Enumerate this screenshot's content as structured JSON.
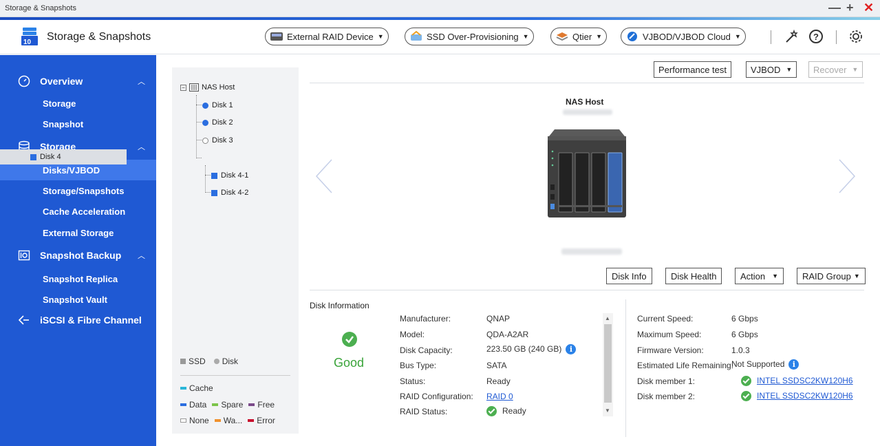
{
  "window": {
    "title": "Storage & Snapshots",
    "minimize": "—",
    "maximize": "+",
    "close": "✕"
  },
  "header": {
    "app_title": "Storage & Snapshots",
    "buttons": [
      {
        "label": "External RAID Device",
        "icon": "raid-device-icon"
      },
      {
        "label": "SSD Over-Provisioning",
        "icon": "ssd-overprovisioning-icon"
      },
      {
        "label": "Qtier",
        "icon": "qtier-icon"
      },
      {
        "label": "VJBOD/VJBOD Cloud",
        "icon": "vjbod-cloud-icon"
      }
    ]
  },
  "sidebar": {
    "groups": [
      {
        "label": "Overview",
        "icon": "speedometer-icon",
        "items": [
          "Storage",
          "Snapshot"
        ]
      },
      {
        "label": "Storage",
        "icon": "database-icon",
        "items": [
          "Disks/VJBOD",
          "Storage/Snapshots",
          "Cache Acceleration",
          "External Storage"
        ]
      },
      {
        "label": "Snapshot Backup",
        "icon": "camera-icon",
        "items": [
          "Snapshot Replica",
          "Snapshot Vault"
        ]
      },
      {
        "label": "iSCSI & Fibre Channel",
        "icon": "iscsi-icon",
        "items": []
      }
    ],
    "active_item": "Disks/VJBOD"
  },
  "tree": {
    "root": "NAS Host",
    "nodes": [
      {
        "label": "Disk 1",
        "type": "disk"
      },
      {
        "label": "Disk 2",
        "type": "disk"
      },
      {
        "label": "Disk 3",
        "type": "empty"
      },
      {
        "label": "Disk 4",
        "type": "ssd"
      },
      {
        "label": "Disk 4-1",
        "type": "ssd"
      },
      {
        "label": "Disk 4-2",
        "type": "ssd"
      }
    ],
    "legend": {
      "ssd": "SSD",
      "disk": "Disk",
      "cache": "Cache",
      "data": "Data",
      "spare": "Spare",
      "free": "Free",
      "none": "None",
      "warning": "Wa...",
      "error": "Error",
      "colors": {
        "cache": "#29b6d8",
        "data": "#2b6ee0",
        "spare": "#7cc44a",
        "free": "#7b4a8a",
        "warning": "#f0912e",
        "error": "#c8102e"
      }
    }
  },
  "top_buttons": {
    "performance": "Performance test",
    "vjbod": "VJBOD",
    "recover": "Recover"
  },
  "device": {
    "title": "NAS Host"
  },
  "action_buttons": {
    "disk_info": "Disk Info",
    "disk_health": "Disk Health",
    "action": "Action",
    "raid_group": "RAID Group"
  },
  "disk_info": {
    "section_label": "Disk Information",
    "status": "Good",
    "left": [
      {
        "key": "Manufacturer:",
        "value": "QNAP"
      },
      {
        "key": "Model:",
        "value": "QDA-A2AR"
      },
      {
        "key": "Disk Capacity:",
        "value": "223.50 GB (240 GB)"
      },
      {
        "key": "Bus Type:",
        "value": "SATA"
      },
      {
        "key": "Status:",
        "value": "Ready"
      },
      {
        "key": "RAID Configuration:",
        "value": "RAID 0"
      },
      {
        "key": "RAID Status:",
        "value": "Ready"
      }
    ],
    "right": [
      {
        "key": "Current Speed:",
        "value": "6 Gbps"
      },
      {
        "key": "Maximum Speed:",
        "value": "6 Gbps"
      },
      {
        "key": "Firmware Version:",
        "value": "1.0.3"
      },
      {
        "key": "Estimated Life Remaining:",
        "value": "Not Supported"
      },
      {
        "key": "Disk member 1:",
        "value": "INTEL SSDSC2KW120H6"
      },
      {
        "key": "Disk member 2:",
        "value": "INTEL SSDSC2KW120H6"
      }
    ]
  }
}
